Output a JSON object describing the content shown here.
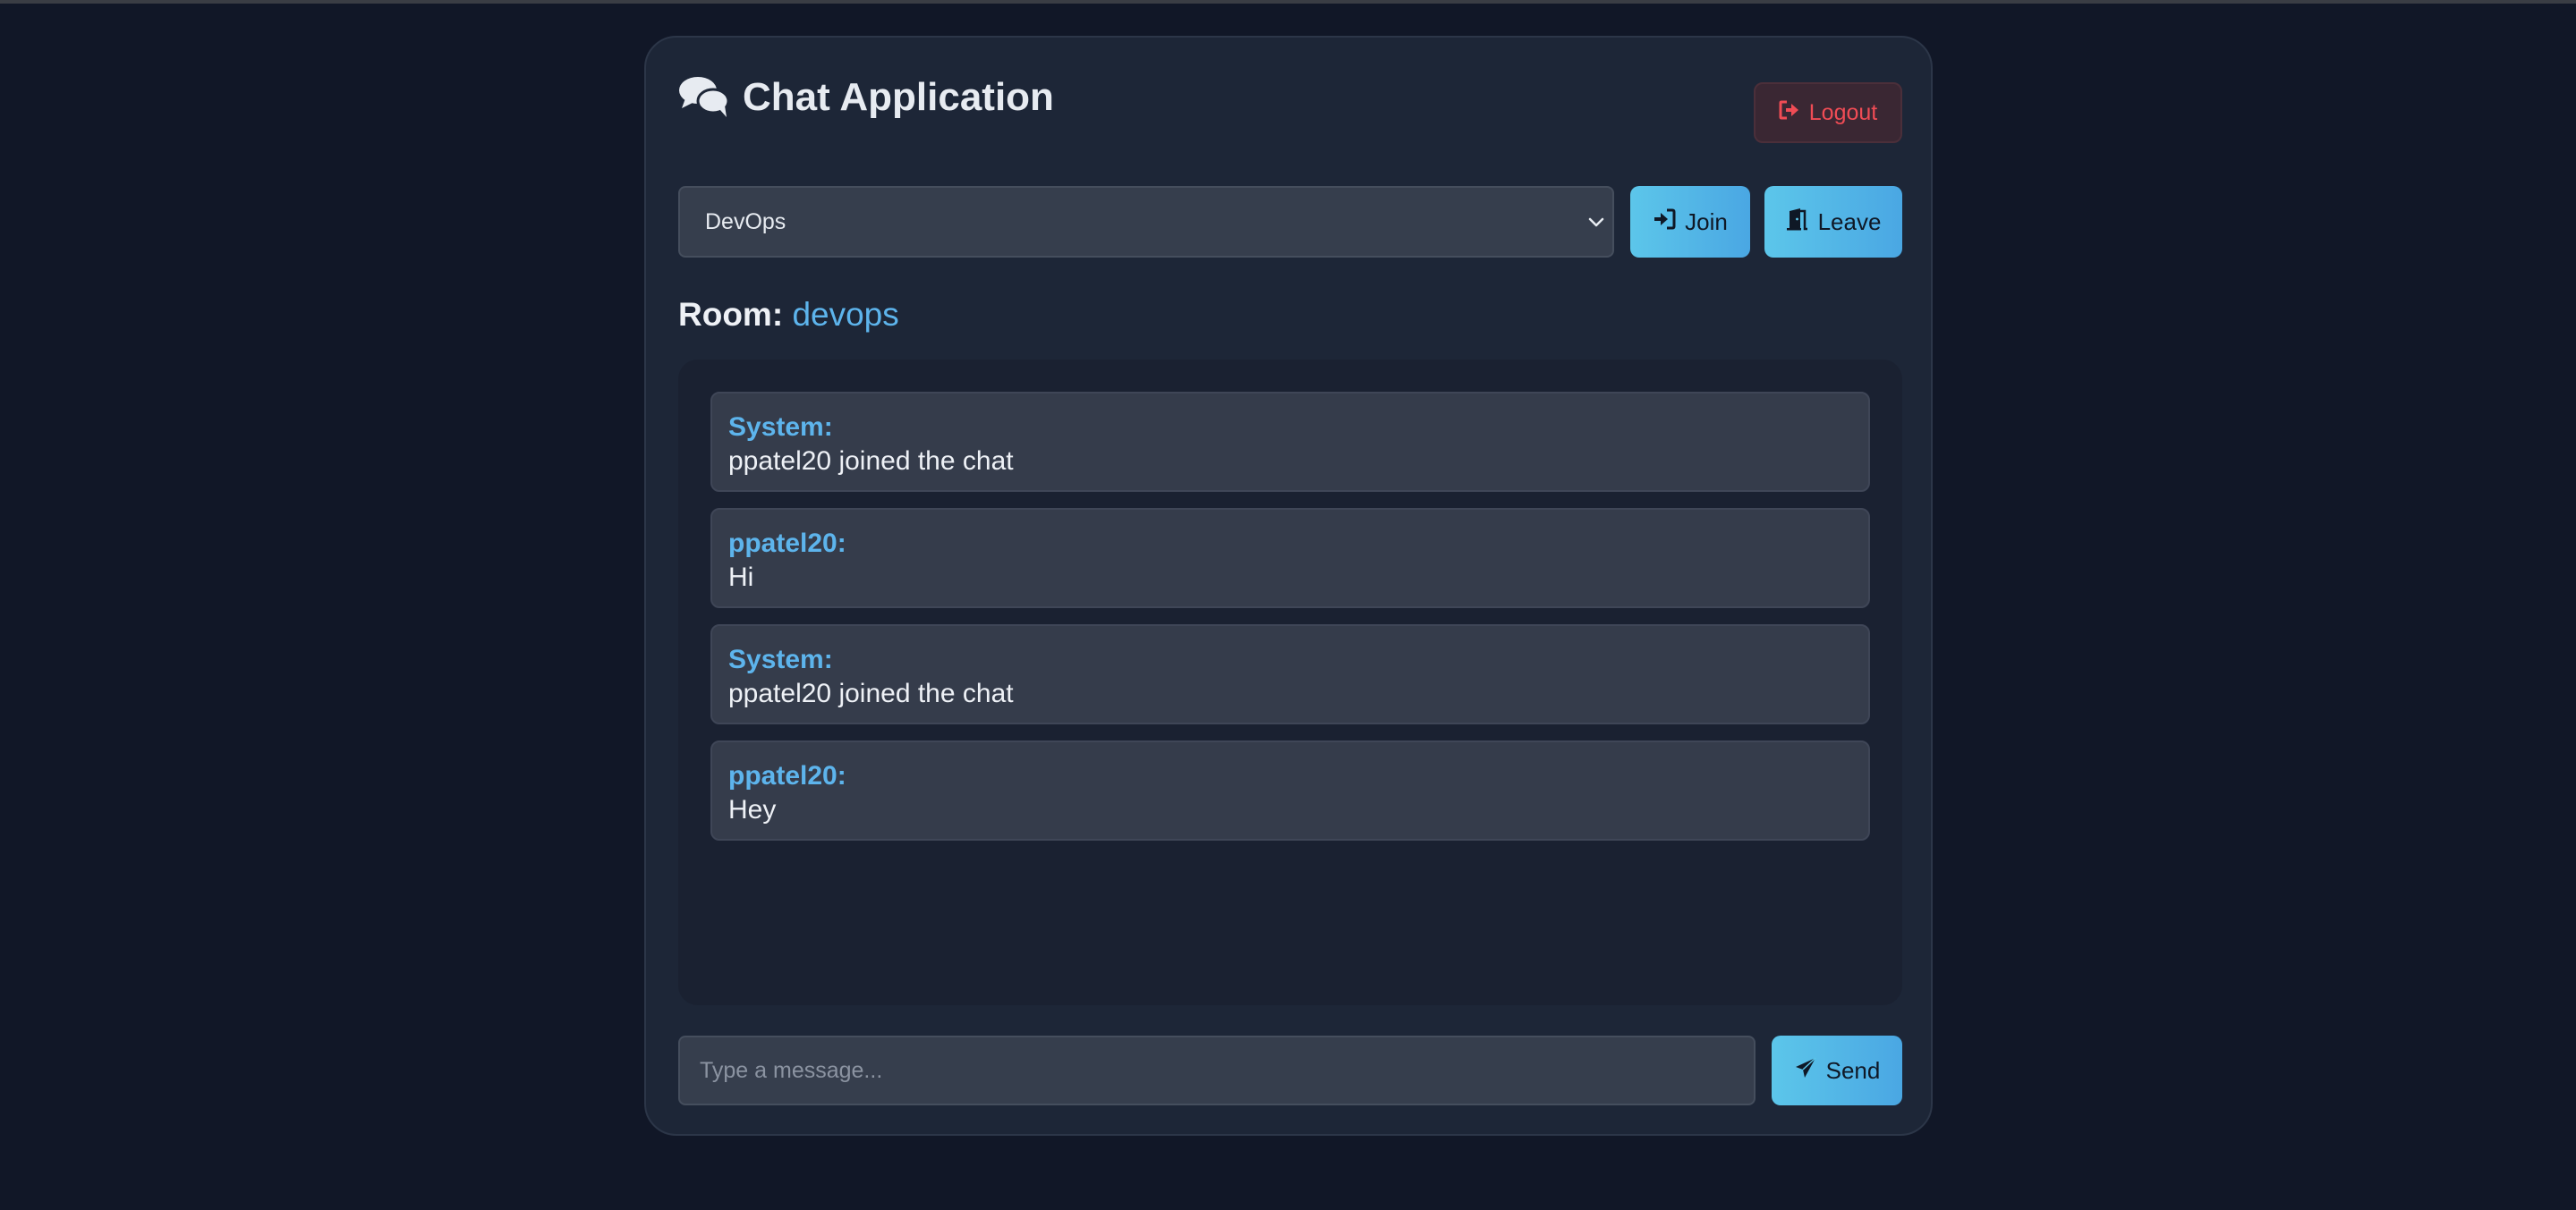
{
  "app": {
    "title": "Chat Application",
    "logout_label": "Logout"
  },
  "room_selector": {
    "selected": "DevOps",
    "join_label": "Join",
    "leave_label": "Leave"
  },
  "room": {
    "label": "Room:",
    "name": "devops"
  },
  "messages": [
    {
      "sender": "System:",
      "text": "ppatel20 joined the chat"
    },
    {
      "sender": "ppatel20:",
      "text": "Hi"
    },
    {
      "sender": "System:",
      "text": "ppatel20 joined the chat"
    },
    {
      "sender": "ppatel20:",
      "text": "Hey"
    }
  ],
  "composer": {
    "placeholder": "Type a message...",
    "value": "",
    "send_label": "Send"
  },
  "colors": {
    "accent": "#5db4ec",
    "danger": "#f04c55",
    "background": "#111727",
    "card": "#1d2637"
  },
  "icons": {
    "header": "comments-icon",
    "logout": "sign-out-icon",
    "join": "sign-in-icon",
    "leave": "door-open-icon",
    "send": "paper-plane-icon"
  }
}
